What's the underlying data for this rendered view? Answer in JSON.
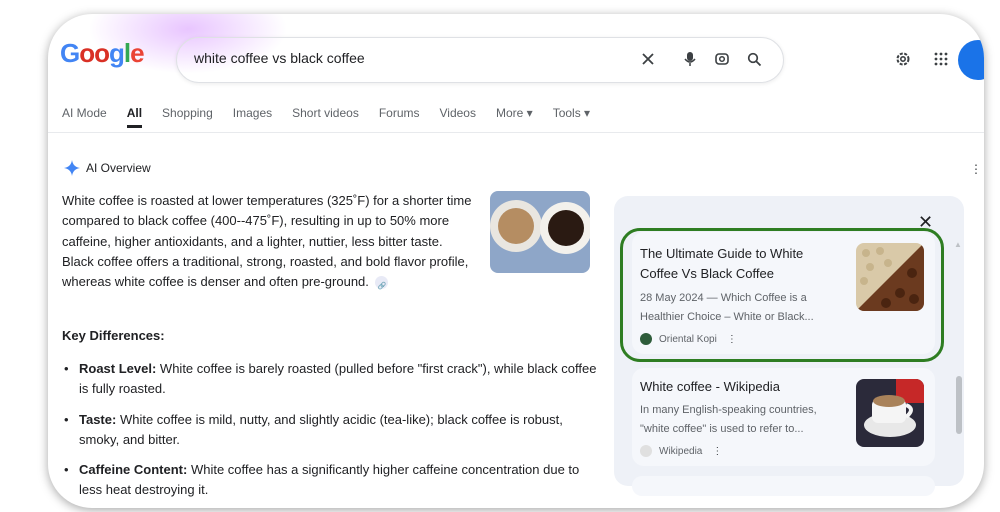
{
  "logo": "Google",
  "search": {
    "query": "white coffee vs black coffee"
  },
  "tabs": [
    "AI Mode",
    "All",
    "Shopping",
    "Images",
    "Short videos",
    "Forums",
    "Videos",
    "More ▾",
    "Tools ▾"
  ],
  "ai_overview": {
    "label": "AI Overview",
    "paragraph": "White coffee is roasted at lower temperatures (325˚F) for a shorter time compared to black coffee (400--475˚F), resulting in up to 50% more caffeine, higher antioxidants, and a lighter, nuttier, less bitter taste. Black coffee offers a traditional, strong, roasted, and bold flavor profile, whereas white coffee is denser and often pre-ground.",
    "key_heading": "Key Differences:",
    "bullets": [
      {
        "term": "Roast Level:",
        "text": " White coffee is barely roasted (pulled before \"first crack\"), while black coffee is fully roasted."
      },
      {
        "term": "Taste:",
        "text": " White coffee is mild, nutty, and slightly acidic (tea-like); black coffee is robust, smoky, and bitter."
      },
      {
        "term": "Caffeine Content:",
        "text": " White coffee has a significantly higher caffeine concentration due to less heat destroying it."
      }
    ]
  },
  "sources": [
    {
      "title": "The Ultimate Guide to White Coffee Vs Black Coffee",
      "snippet": "28 May 2024 — Which Coffee is a Healthier Choice – White or Black...",
      "site": "Oriental Kopi",
      "color": "#2e5c3a"
    },
    {
      "title": "White coffee - Wikipedia",
      "snippet": "In many English-speaking countries, \"white coffee\" is used to refer to...",
      "site": "Wikipedia",
      "color": "#9e9e9e"
    }
  ],
  "colors": {
    "highlight": "#2e7d22",
    "accent": "#1a73e8"
  }
}
